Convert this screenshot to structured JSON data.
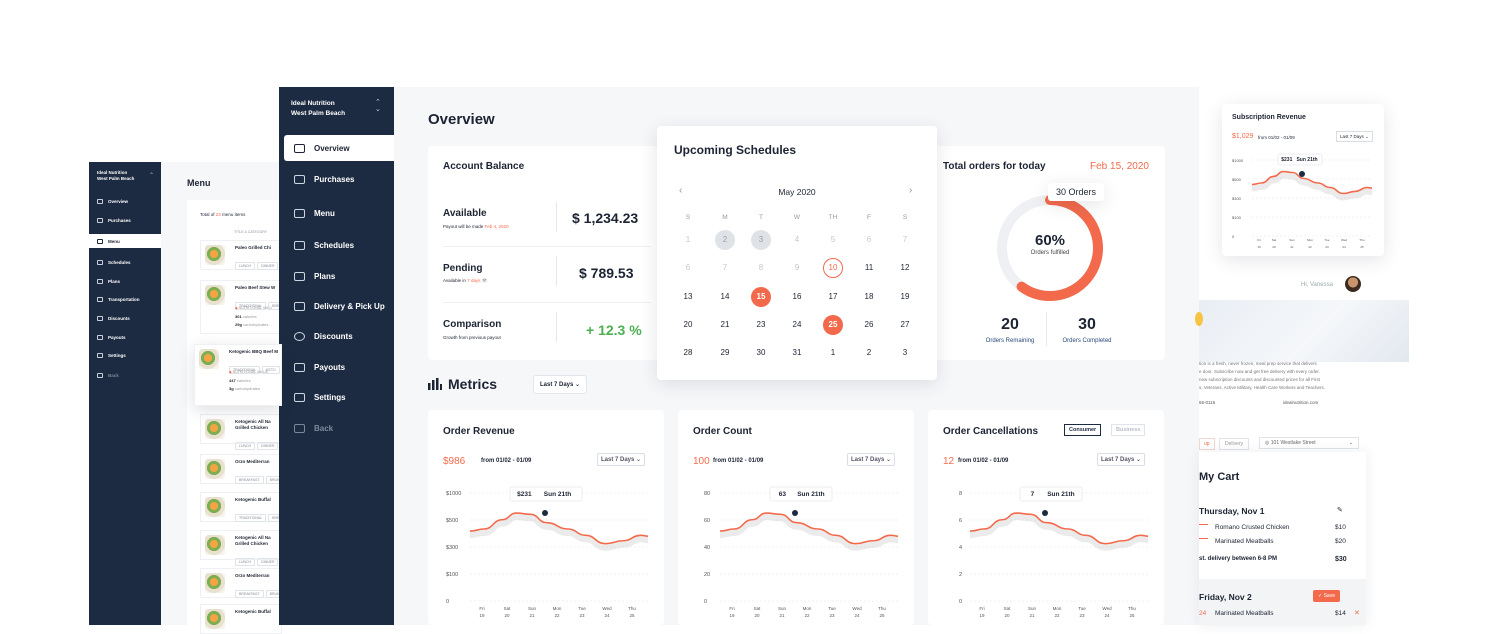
{
  "left_app": {
    "brand_line1": "Ideal Nutrition",
    "brand_line2": "West Palm Beach",
    "nav": [
      "Overview",
      "Purchases",
      "Menu",
      "Schedules",
      "Plans",
      "Transportation",
      "Discounts",
      "Payouts",
      "Settings",
      "Back"
    ],
    "menu_title": "Menu",
    "total_prefix": "Total of",
    "total_count": "23",
    "total_suffix": "menu items",
    "col_header": "TITLE & CATEGORY",
    "items": [
      {
        "name": "Paleo Grilled Chi",
        "tags": [
          "LUNCH",
          "DINNER"
        ]
      },
      {
        "name": "Paleo Beef Stew W",
        "tags": [
          "TRADITIONAL",
          "BREAKF"
        ],
        "nutri": "NUTRITIONAL VALU",
        "cal": "301",
        "cal_label": "calories",
        "carb": "29g",
        "carb_label": "carbohydrates"
      },
      {
        "name": "Ketogenic BBQ Beef M",
        "tags": [
          "TRADITIONAL",
          "KETO"
        ],
        "nutri": "NUTRITIONAL VALUE",
        "cal": "447",
        "cal_label": "calories",
        "carb": "3g",
        "carb_label": "carbohydrates"
      },
      {
        "name": "Ketogenic All Na",
        "name2": "Grilled Chicken",
        "tags": [
          "LUNCH",
          "DINNER"
        ]
      },
      {
        "name": "Orzo Mediterran",
        "tags": [
          "BREAKFAST",
          "BRUNCH"
        ]
      },
      {
        "name": "Ketogenic Buffal",
        "tags": [
          "TRADITIONAL",
          "BREAKF"
        ]
      },
      {
        "name": "Ketogenic All Na",
        "name2": "Grilled Chicken",
        "tags": [
          "LUNCH",
          "DINNER"
        ]
      },
      {
        "name": "Orzo Mediterran",
        "tags": [
          "BREAKFAST",
          "BRUNCH"
        ]
      },
      {
        "name": "Ketogenic Buffal",
        "tags": []
      }
    ]
  },
  "sidebar": {
    "brand_line1": "Ideal Nutrition",
    "brand_line2": "West Palm Beach",
    "items": [
      "Overview",
      "Purchases",
      "Menu",
      "Schedules",
      "Plans",
      "Delivery & Pick Up",
      "Discounts",
      "Payouts",
      "Settings",
      "Back"
    ],
    "icons": [
      "home-icon",
      "clipboard-icon",
      "menu-icon",
      "calendar-icon",
      "handshake-icon",
      "truck-icon",
      "discount-icon",
      "wallet-icon",
      "gear-icon",
      "exit-icon"
    ]
  },
  "overview": {
    "title": "Overview",
    "account_balance": {
      "title": "Account Balance",
      "available_label": "Available",
      "available_note_prefix": "Payout will be made",
      "available_note_date": "Feb 4, 2020",
      "available_value": "$ 1,234.23",
      "pending_label": "Pending",
      "pending_note_prefix": "Available in",
      "pending_note_days": "7 days",
      "pending_value": "$ 789.53",
      "comparison_label": "Comparison",
      "comparison_note": "Growth from previous payout",
      "comparison_value": "+ 12.3 %"
    },
    "schedules": {
      "title": "Upcoming Schedules",
      "month": "May 2020",
      "weekdays": [
        "S",
        "M",
        "T",
        "W",
        "TH",
        "F",
        "S"
      ],
      "rows": [
        [
          "1",
          "2",
          "3",
          "4",
          "5",
          "6",
          "7"
        ],
        [
          "6",
          "7",
          "8",
          "9",
          "10",
          "11",
          "12"
        ],
        [
          "13",
          "14",
          "15",
          "16",
          "17",
          "18",
          "19"
        ],
        [
          "20",
          "21",
          "23",
          "24",
          "25",
          "26",
          "27"
        ],
        [
          "28",
          "29",
          "30",
          "31",
          "1",
          "2",
          "3"
        ]
      ]
    },
    "orders": {
      "title": "Total orders for today",
      "date": "Feb 15, 2020",
      "badge": "30 Orders",
      "percent": 60,
      "percent_label": "60%",
      "fulfilled_label": "Orders fulfilled",
      "remaining_value": "20",
      "remaining_label": "Orders Remaining",
      "completed_value": "30",
      "completed_label": "Orders Completed"
    },
    "metrics_title": "Metrics",
    "metrics_range": "Last 7 Days",
    "cards": [
      {
        "title": "Order Revenue",
        "value": "$986",
        "range_text": "from 01/02 - 01/09",
        "dropdown": "Last 7 Days",
        "tip_value": "$231",
        "tip_date": "Sun 21th",
        "yticks": [
          "$1000",
          "$500",
          "$300",
          "$100",
          "0"
        ]
      },
      {
        "title": "Order Count",
        "value": "100",
        "range_text": "from 01/02 - 01/09",
        "dropdown": "Last 7 Days",
        "tip_value": "63",
        "tip_date": "Sun 21th",
        "yticks": [
          "80",
          "60",
          "40",
          "20",
          "0"
        ]
      },
      {
        "title": "Order Cancellations",
        "value": "12",
        "range_text": "from 01/02 - 01/09",
        "dropdown": "Last 7 Days",
        "tip_value": "7",
        "tip_date": "Sun 21th",
        "yticks": [
          "8",
          "6",
          "4",
          "2",
          "0"
        ],
        "toggle": [
          "Consumer",
          "Business"
        ]
      }
    ],
    "xdays": [
      "Fri",
      "Sat",
      "Sun",
      "Mon",
      "Tue",
      "Wed",
      "Thu"
    ],
    "xdates": [
      "19",
      "20",
      "21",
      "22",
      "23",
      "24",
      "25"
    ]
  },
  "subscription": {
    "title": "Subscription Revenue",
    "value": "$1,029",
    "range_text": "from 01/02 - 01/09",
    "dropdown": "Last 7 Days",
    "tip_value": "$231",
    "tip_date": "Sun 21th",
    "yticks": [
      "$1000",
      "$500",
      "$300",
      "$100",
      "0"
    ],
    "xdays": [
      "Fri",
      "Sat",
      "Sun",
      "Mon",
      "Tue",
      "Wed",
      "Thu"
    ],
    "xdates": [
      "19",
      "20",
      "21",
      "22",
      "23",
      "24",
      "25"
    ]
  },
  "storefront": {
    "greeting": "Hi, Vanessa",
    "desc": [
      "tion is a fresh, never frozen, meal prep service that delivers",
      "e door. Subscribe now and get free delivery with every order.",
      "new subscription discounts and discounted prices for all First",
      "s, Veterans, Active Military, Health Care Workers and Teachers."
    ],
    "phone": "55-0115",
    "website": "idealnutrition.com",
    "tabs": [
      "up",
      "Delivery"
    ],
    "address": "101 Westlake Street"
  },
  "cart": {
    "title": "My Cart",
    "day1": "Thursday, Nov 1",
    "items1": [
      {
        "name": "Romano Crusted Chicken",
        "price": "$10"
      },
      {
        "name": "Marinated Meatballs",
        "price": "$20"
      }
    ],
    "delivery_note": "st. delivery between 6-8 PM",
    "subtotal": "$30",
    "day2": "Friday, Nov 2",
    "save_label": "Save",
    "items2": [
      {
        "qty": "24",
        "name": "Marinated Meatballs",
        "price": "$14"
      }
    ]
  }
}
